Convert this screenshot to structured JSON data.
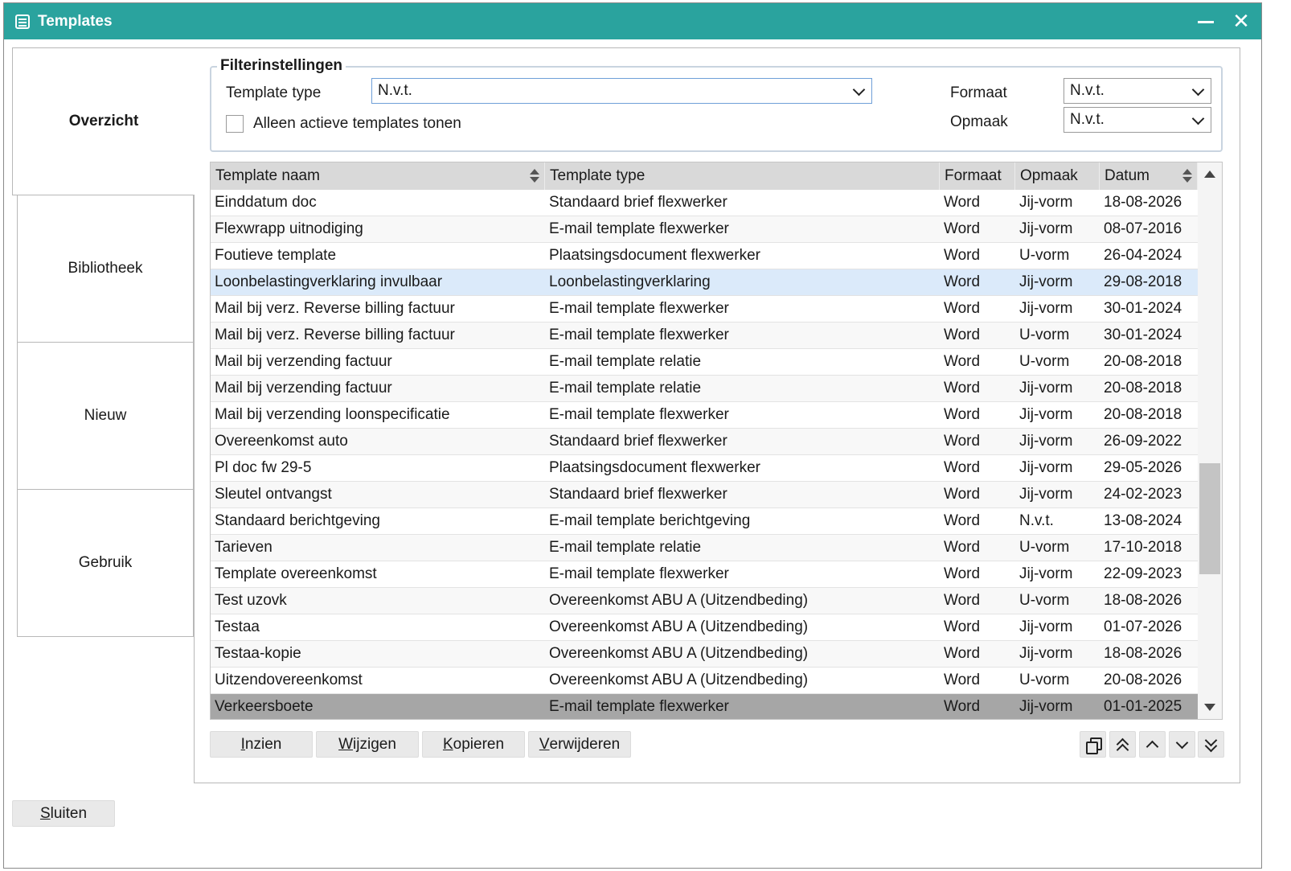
{
  "window": {
    "title": "Templates"
  },
  "tabs": [
    {
      "label": "Overzicht",
      "active": true
    },
    {
      "label": "Bibliotheek",
      "active": false
    },
    {
      "label": "Nieuw",
      "active": false
    },
    {
      "label": "Gebruik",
      "active": false
    }
  ],
  "filter": {
    "legend": "Filterinstellingen",
    "template_type_label": "Template type",
    "template_type_value": "N.v.t.",
    "only_active_label": "Alleen actieve templates tonen",
    "only_active_checked": false,
    "formaat_label": "Formaat",
    "formaat_value": "N.v.t.",
    "opmaak_label": "Opmaak",
    "opmaak_value": "N.v.t."
  },
  "table": {
    "columns": [
      "Template naam",
      "Template type",
      "Formaat",
      "Opmaak",
      "Datum"
    ],
    "rows": [
      [
        "Einddatum doc",
        "Standaard brief flexwerker",
        "Word",
        "Jij-vorm",
        "18-08-2026"
      ],
      [
        "Flexwrapp uitnodiging",
        "E-mail template flexwerker",
        "Word",
        "Jij-vorm",
        "08-07-2016"
      ],
      [
        "Foutieve template",
        "Plaatsingsdocument flexwerker",
        "Word",
        "U-vorm",
        "26-04-2024"
      ],
      [
        "Loonbelastingverklaring invulbaar",
        "Loonbelastingverklaring",
        "Word",
        "Jij-vorm",
        "29-08-2018"
      ],
      [
        "Mail bij verz. Reverse billing factuur",
        "E-mail template flexwerker",
        "Word",
        "Jij-vorm",
        "30-01-2024"
      ],
      [
        "Mail bij verz. Reverse billing factuur",
        "E-mail template flexwerker",
        "Word",
        "U-vorm",
        "30-01-2024"
      ],
      [
        "Mail bij verzending factuur",
        "E-mail template relatie",
        "Word",
        "U-vorm",
        "20-08-2018"
      ],
      [
        "Mail bij verzending factuur",
        "E-mail template relatie",
        "Word",
        "Jij-vorm",
        "20-08-2018"
      ],
      [
        "Mail bij verzending loonspecificatie",
        "E-mail template flexwerker",
        "Word",
        "Jij-vorm",
        "20-08-2018"
      ],
      [
        "Overeenkomst auto",
        "Standaard brief flexwerker",
        "Word",
        "Jij-vorm",
        "26-09-2022"
      ],
      [
        "Pl doc fw 29-5",
        "Plaatsingsdocument flexwerker",
        "Word",
        "Jij-vorm",
        "29-05-2026"
      ],
      [
        "Sleutel ontvangst",
        "Standaard brief flexwerker",
        "Word",
        "Jij-vorm",
        "24-02-2023"
      ],
      [
        "Standaard berichtgeving",
        "E-mail template berichtgeving",
        "Word",
        "N.v.t.",
        "13-08-2024"
      ],
      [
        "Tarieven",
        "E-mail template relatie",
        "Word",
        "U-vorm",
        "17-10-2018"
      ],
      [
        "Template overeenkomst",
        "E-mail template flexwerker",
        "Word",
        "Jij-vorm",
        "22-09-2023"
      ],
      [
        "Test uzovk",
        "Overeenkomst ABU A (Uitzendbeding)",
        "Word",
        "U-vorm",
        "18-08-2026"
      ],
      [
        "Testaa",
        "Overeenkomst ABU A (Uitzendbeding)",
        "Word",
        "Jij-vorm",
        "01-07-2026"
      ],
      [
        "Testaa-kopie",
        "Overeenkomst ABU A (Uitzendbeding)",
        "Word",
        "Jij-vorm",
        "18-08-2026"
      ],
      [
        "Uitzendovereenkomst",
        "Overeenkomst ABU A (Uitzendbeding)",
        "Word",
        "U-vorm",
        "20-08-2026"
      ],
      [
        "Verkeersboete",
        "E-mail template flexwerker",
        "Word",
        "Jij-vorm",
        "01-01-2025"
      ]
    ],
    "hover_row": 3,
    "selected_row": 19
  },
  "actions": {
    "inzien": {
      "mnemonic": "I",
      "rest": "nzien"
    },
    "wijzigen": {
      "mnemonic": "W",
      "rest": "ijzigen"
    },
    "kopieren": {
      "mnemonic": "K",
      "rest": "opieren"
    },
    "verwijderen": {
      "mnemonic": "V",
      "rest": "erwijderen"
    }
  },
  "footer": {
    "sluiten": {
      "mnemonic": "S",
      "rest": "luiten"
    }
  },
  "colors": {
    "titlebar": "#2aa39e",
    "highlight_row": "#dbeafa",
    "selected_row": "#a6a6a6"
  }
}
